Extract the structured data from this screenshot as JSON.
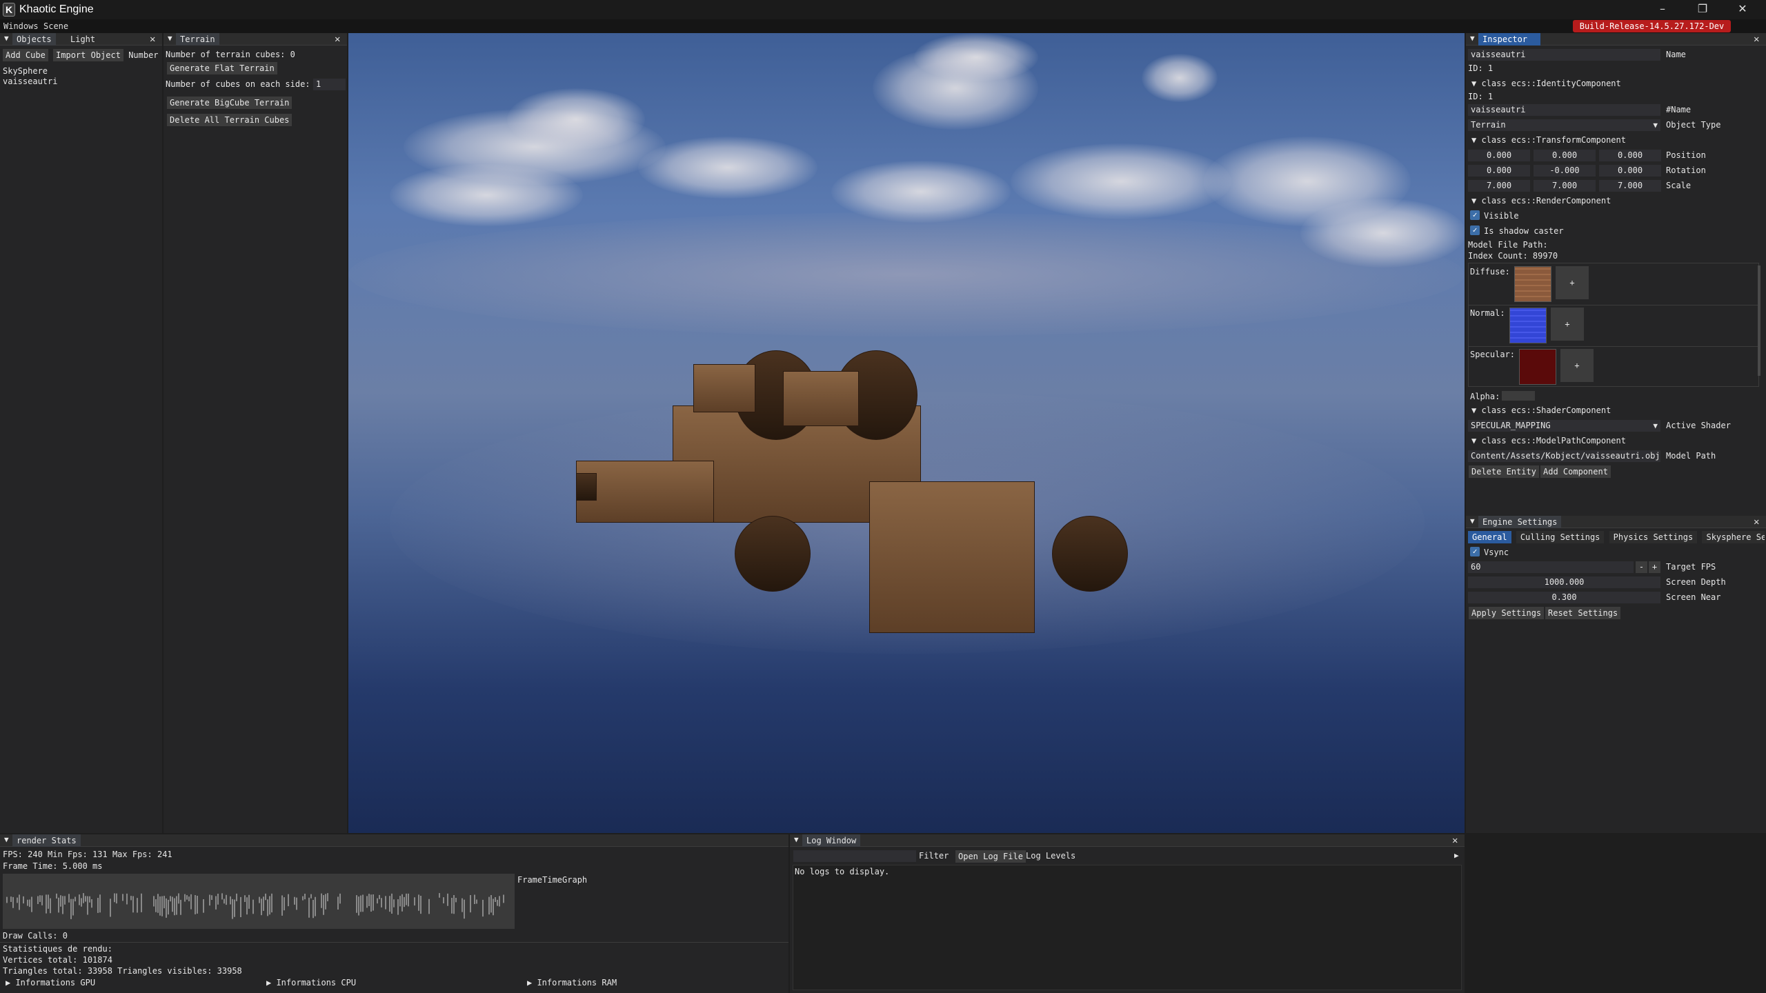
{
  "window": {
    "title": "Khaotic Engine",
    "logo_letter": "K",
    "minimize": "–",
    "restore": "❐",
    "close": "✕"
  },
  "menu": [
    "Windows",
    "Scene"
  ],
  "build_badge": "Build-Release-14.5.27.172-Dev",
  "objects_panel": {
    "tabs": [
      "Objects",
      "Light"
    ],
    "add_cube": "Add Cube",
    "import_object": "Import Object",
    "number_label": "Number o",
    "items": [
      "SkySphere",
      "vaisseautri"
    ]
  },
  "terrain_panel": {
    "title": "Terrain",
    "count_label": "Number of terrain cubes: 0",
    "gen_flat": "Generate Flat Terrain",
    "cubes_side_label": "Number of cubes on each side:",
    "cubes_side_value": "1",
    "gen_bigcube": "Generate BigCube Terrain",
    "delete_all": "Delete All Terrain Cubes"
  },
  "inspector": {
    "title": "Inspector",
    "name_value": "vaisseautri",
    "name_label": "Name",
    "id_line": "ID: 1",
    "identity_header": "class ecs::IdentityComponent",
    "id_line2": "ID: 1",
    "name2_value": "vaisseautri",
    "name2_label": "#Name",
    "object_type_value": "Terrain",
    "object_type_label": "Object Type",
    "transform_header": "class ecs::TransformComponent",
    "position": [
      "0.000",
      "0.000",
      "0.000"
    ],
    "position_label": "Position",
    "rotation": [
      "0.000",
      "-0.000",
      "0.000"
    ],
    "rotation_label": "Rotation",
    "scale": [
      "7.000",
      "7.000",
      "7.000"
    ],
    "scale_label": "Scale",
    "render_header": "class ecs::RenderComponent",
    "visible_label": "Visible",
    "shadow_label": "Is shadow caster",
    "model_file_path": "Model File Path:",
    "index_count": "Index Count: 89970",
    "diffuse_label": "Diffuse:",
    "normal_label": "Normal:",
    "specular_label": "Specular:",
    "alpha_label": "Alpha:",
    "plus": "+",
    "shader_header": "class ecs::ShaderComponent",
    "shader_value": "SPECULAR_MAPPING",
    "shader_label": "Active Shader",
    "modelpath_header": "class ecs::ModelPathComponent",
    "model_path_value": "Content/Assets/Kobject/vaisseautri.obj",
    "model_path_label": "Model Path",
    "delete_entity": "Delete Entity",
    "add_component": "Add Component"
  },
  "engine_settings": {
    "title": "Engine Settings",
    "tabs": [
      "General",
      "Culling Settings",
      "Physics Settings",
      "Skysphere Setti"
    ],
    "vsync_label": "Vsync",
    "target_fps_value": "60",
    "target_fps_label": "Target FPS",
    "minus": "-",
    "plus": "+",
    "screen_depth_value": "1000.000",
    "screen_depth_label": "Screen Depth",
    "screen_near_value": "0.300",
    "screen_near_label": "Screen Near",
    "apply": "Apply Settings",
    "reset": "Reset Settings"
  },
  "render_stats": {
    "title": "render Stats",
    "fps_line": "FPS: 240 Min Fps: 131 Max Fps: 241",
    "frame_time": "Frame Time: 5.000 ms",
    "graph_label": "FrameTimeGraph",
    "draw_calls": "Draw Calls: 0",
    "stats_header": "Statistiques de rendu:",
    "vertices": "Vertices total: 101874",
    "triangles": "Triangles total: 33958 Triangles visibles: 33958",
    "info_gpu": "Informations GPU",
    "info_cpu": "Informations CPU",
    "info_ram": "Informations RAM"
  },
  "log_window": {
    "title": "Log Window",
    "filter_label": "Filter",
    "open_log": "Open Log File",
    "log_levels": "Log Levels",
    "empty": "No logs to display."
  },
  "colors": {
    "accent": "#2b5b9e",
    "badge": "#b71c1c",
    "diffuse_swatch": "#8b5a3c",
    "normal_swatch": "#3346d6",
    "specular_swatch": "#5a0a0a"
  }
}
